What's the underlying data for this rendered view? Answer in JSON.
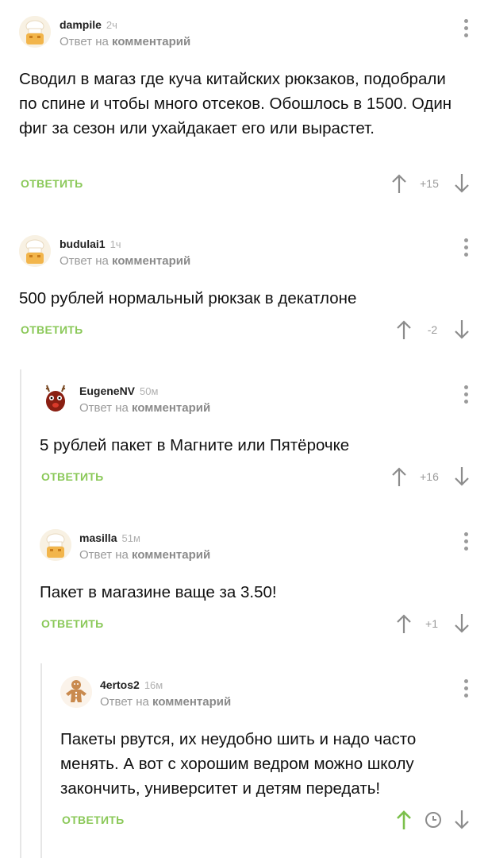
{
  "labels": {
    "reply_to": "Ответ на",
    "comment_word": "комментарий",
    "reply": "ОТВЕТИТЬ"
  },
  "comments": [
    {
      "username": "dampile",
      "time": "2ч",
      "text": "Сводил в магаз где куча китайских рюкзаков, подобрали по спине и чтобы много отсеков. Обошлось в 1500. Один фиг за сезон или ухайдакает его или вырастет.",
      "rating": "+15",
      "avatar": "chef-avatar-icon"
    },
    {
      "username": "budulai1",
      "time": "1ч",
      "text": "500 рублей нормальный рюкзак в декатлоне",
      "rating": "-2",
      "avatar": "chef-avatar-icon"
    },
    {
      "username": "EugeneNV",
      "time": "50м",
      "text": "5 рублей пакет в Магните или Пятёрочке",
      "rating": "+16",
      "avatar": "reindeer-avatar-icon"
    },
    {
      "username": "masilla",
      "time": "51м",
      "text": "Пакет в магазине ваще за 3.50!",
      "rating": "+1",
      "avatar": "chef-avatar-icon"
    },
    {
      "username": "4ertos2",
      "time": "16м",
      "text": "Пакеты рвутся, их неудобно шить и надо часто менять. А вот с хорошим ведром можно школу закончить, университет и детям передать!",
      "rating": "",
      "avatar": "gingerbread-avatar-icon",
      "upvoted": true
    }
  ],
  "colors": {
    "reply_green": "#8ac858",
    "upvote_active": "#7cc04c",
    "icon_gray": "#8c8c8c",
    "thread_line": "#e6e6e6"
  }
}
